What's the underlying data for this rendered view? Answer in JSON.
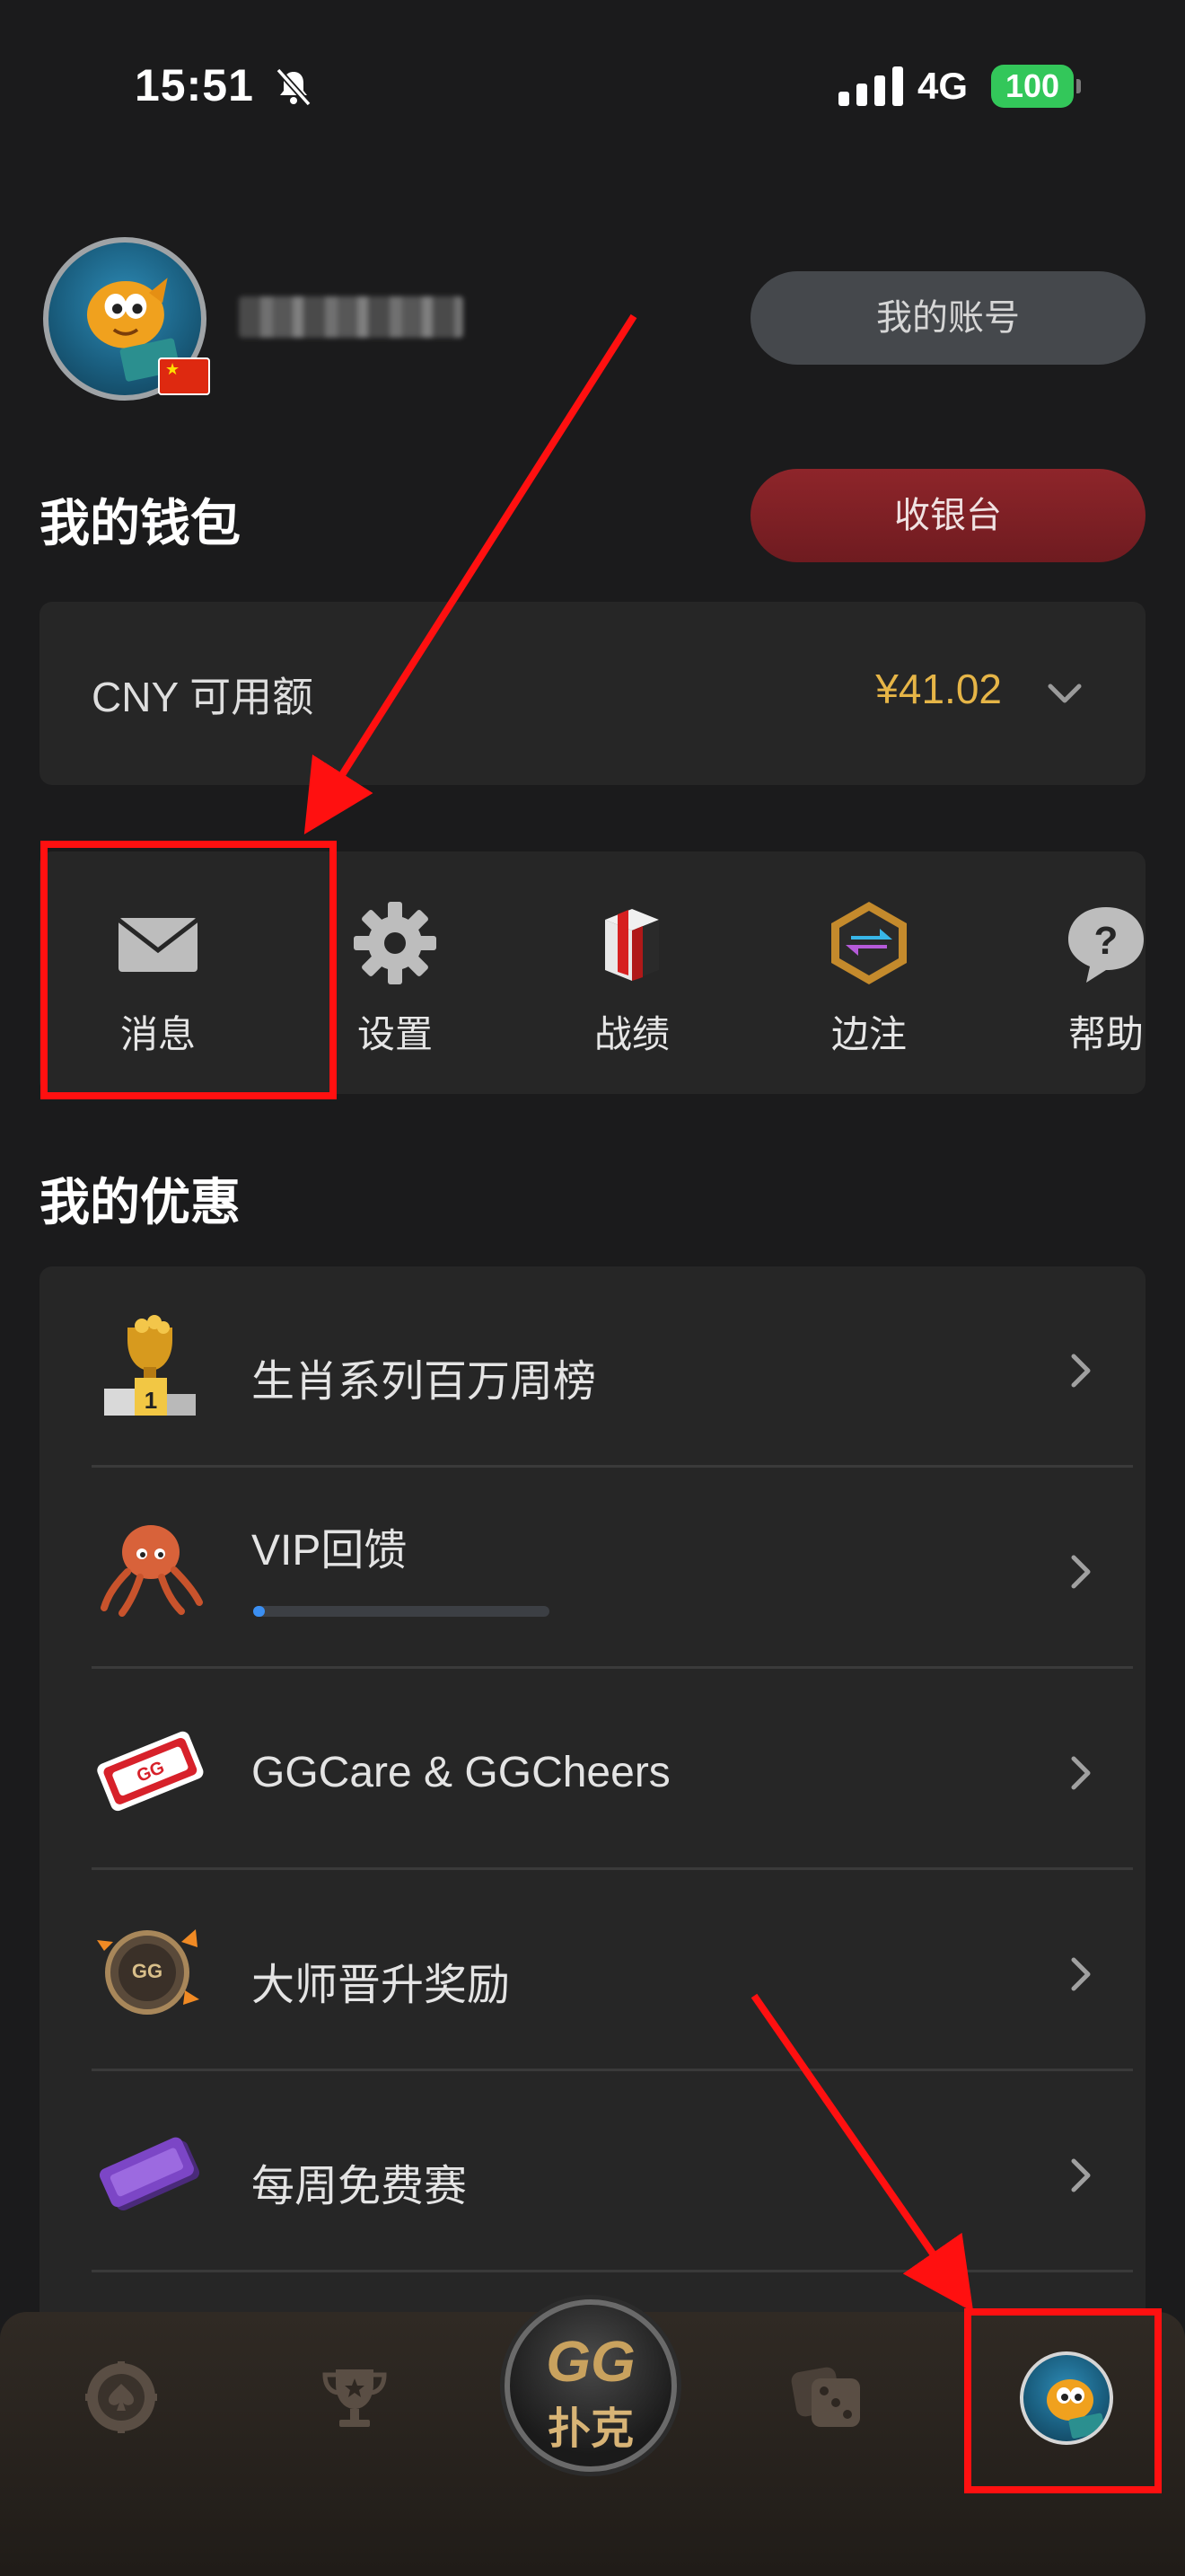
{
  "status_bar": {
    "time": "15:51",
    "network": "4G",
    "battery": "100"
  },
  "profile": {
    "account_button": "我的账号"
  },
  "wallet": {
    "heading": "我的钱包",
    "cashier_button": "收银台",
    "balance_label": "CNY 可用额",
    "balance_amount": "¥41.02"
  },
  "quick_actions": [
    {
      "label": "消息",
      "icon": "envelope-icon"
    },
    {
      "label": "设置",
      "icon": "gear-icon"
    },
    {
      "label": "战绩",
      "icon": "stats-cube-icon"
    },
    {
      "label": "边注",
      "icon": "side-bet-hex-icon"
    },
    {
      "label": "帮助",
      "icon": "help-bubble-icon"
    }
  ],
  "offers": {
    "heading": "我的优惠",
    "items": [
      {
        "title": "生肖系列百万周榜",
        "icon": "trophy-podium-icon"
      },
      {
        "title": "VIP回馈",
        "icon": "octopus-icon",
        "progress": 0.04
      },
      {
        "title": "GGCare & GGCheers",
        "icon": "ggcheers-ticket-icon"
      },
      {
        "title": "大师晋升奖励",
        "icon": "gg-masters-badge-icon"
      },
      {
        "title": "每周免费赛",
        "icon": "free-ticket-icon"
      }
    ]
  },
  "bottom_nav": {
    "items": [
      "poker-chip-icon",
      "trophy-icon",
      "gg-poker-logo",
      "dice-icon",
      "profile-avatar"
    ],
    "logo_line1": "GG",
    "logo_line2": "扑克",
    "active": "profile-avatar"
  },
  "annotations": {
    "color": "#ff1010"
  },
  "colors": {
    "accent_gold": "#e6b547",
    "cashier_red": "#8e252a",
    "progress_blue": "#3b8ff2"
  }
}
